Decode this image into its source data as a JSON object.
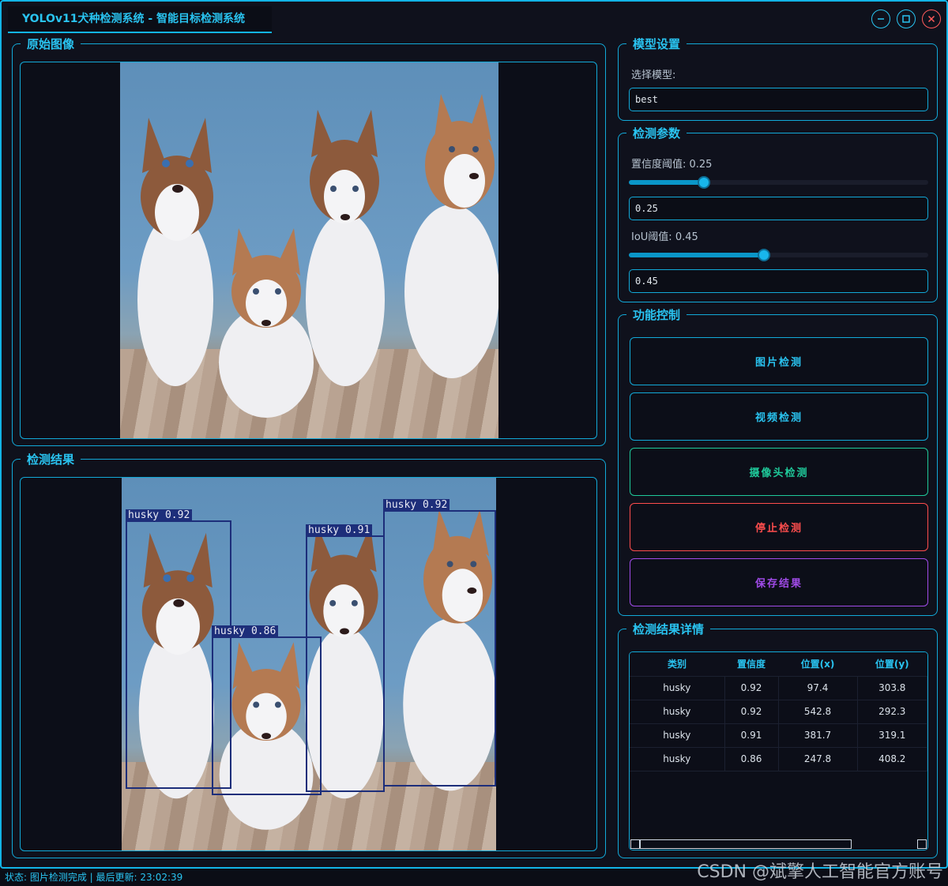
{
  "window": {
    "title": "YOLOv11犬种检测系统 - 智能目标检测系统"
  },
  "panels": {
    "original": {
      "title": "原始图像"
    },
    "result": {
      "title": "检测结果"
    },
    "model": {
      "title": "模型设置",
      "select_label": "选择模型:",
      "selected_model": "best"
    },
    "params": {
      "title": "检测参数",
      "confidence_label": "置信度阈值: 0.25",
      "confidence_value": "0.25",
      "confidence_level": 0.25,
      "iou_label": "IoU阈值: 0.45",
      "iou_value": "0.45",
      "iou_level": 0.45
    },
    "controls": {
      "title": "功能控制",
      "image_detect": "图片检测",
      "video_detect": "视频检测",
      "camera_detect": "摄像头检测",
      "stop_detect": "停止检测",
      "save_result": "保存结果"
    },
    "details": {
      "title": "检测结果详情",
      "headers": [
        "类别",
        "置信度",
        "位置(x)",
        "位置(y)"
      ],
      "rows": [
        [
          "husky",
          "0.92",
          "97.4",
          "303.8"
        ],
        [
          "husky",
          "0.92",
          "542.8",
          "292.3"
        ],
        [
          "husky",
          "0.91",
          "381.7",
          "319.1"
        ],
        [
          "husky",
          "0.86",
          "247.8",
          "408.2"
        ]
      ]
    }
  },
  "detections": [
    {
      "label": "husky 0.92"
    },
    {
      "label": "husky 0.86"
    },
    {
      "label": "husky 0.91"
    },
    {
      "label": "husky 0.92"
    }
  ],
  "status": {
    "text": "状态: 图片检测完成 | 最后更新: 23:02:39"
  },
  "watermark": "CSDN @斌擎人工智能官方账号",
  "colors": {
    "accent": "#12b4e6",
    "camera": "#1fc99a",
    "stop": "#ff4d4d",
    "save": "#a04be8"
  }
}
